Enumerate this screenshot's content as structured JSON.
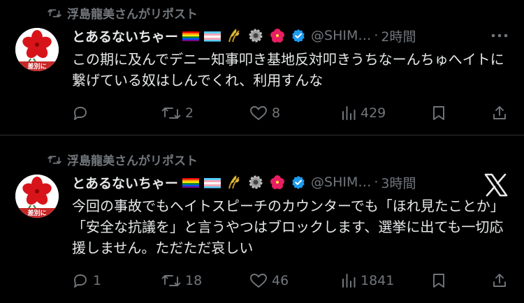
{
  "colors": {
    "background": "#000000",
    "text": "#e7e9ea",
    "muted": "#71767b",
    "verified": "#1d9bf0",
    "divider": "#2f3336"
  },
  "tweets": [
    {
      "repost_label": "浮島龍美さんがリポスト",
      "author_name": "とあるないちゃー",
      "handle": "@SHIM…",
      "separator": "·",
      "time": "2時間",
      "text": "この期に及んでデニー知事叩き基地反対叩きうちなーんちゅへイトに繋げている奴はしんでくれ、利用すんな",
      "avatar_text": "差別に",
      "replies": "",
      "reposts": "2",
      "likes": "8",
      "views": "429"
    },
    {
      "repost_label": "浮島龍美さんがリポスト",
      "author_name": "とあるないちゃー",
      "handle": "@SHIM…",
      "separator": "·",
      "time": "3時間",
      "text": "今回の事故でもヘイトスピーチのカウンターでも「ほれ見たことか」「安全な抗議を」と言うやつはブロックします、選挙に出ても一切応援しません。ただただ哀しい",
      "avatar_text": "差別に",
      "replies": "1",
      "reposts": "18",
      "likes": "46",
      "views": "1841"
    }
  ],
  "icons": [
    "repost-icon",
    "rainbow-flag-icon",
    "trans-flag-icon",
    "rice-icon",
    "gear-icon",
    "hibiscus-icon",
    "verified-badge-icon",
    "more-icon",
    "reply-icon",
    "like-icon",
    "views-icon",
    "bookmark-icon",
    "share-icon",
    "x-logo-icon"
  ]
}
